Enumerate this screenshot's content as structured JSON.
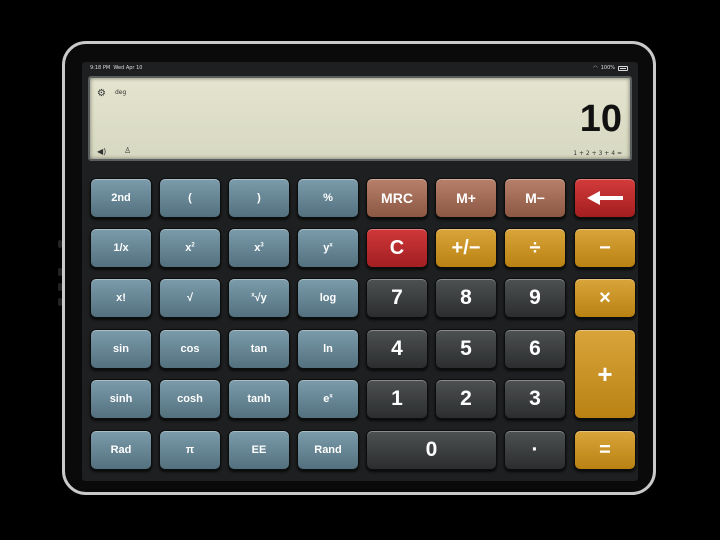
{
  "status_bar": {
    "time": "9:18 PM",
    "date": "Wed Apr 10",
    "battery": "100%",
    "wifi_icon": "wifi-icon",
    "battery_icon": "battery-icon"
  },
  "display": {
    "mode": "deg",
    "value": "10",
    "expression": "1 + 2 + 3 + 4 =",
    "settings_icon": "gear-icon",
    "sound_icon": "speaker-icon",
    "theme_icon": "shirt-icon"
  },
  "keys": {
    "row1": {
      "k1": "2nd",
      "k2": "(",
      "k3": ")",
      "k4": "%",
      "mrc": "MRC",
      "mplus": "M+",
      "mminus": "M−",
      "backspace_icon": "backspace-arrow-icon"
    },
    "row2": {
      "k1": "1/x",
      "k2_base": "x",
      "k2_sup": "2",
      "k3_base": "x",
      "k3_sup": "3",
      "k4_base": "y",
      "k4_sup": "x",
      "clear": "C",
      "sign": "+/−",
      "divide": "÷",
      "minus": "−"
    },
    "row3": {
      "k1": "x!",
      "k2": "√",
      "k3_sup": "x",
      "k3_base": "√y",
      "k4": "log",
      "n7": "7",
      "n8": "8",
      "n9": "9",
      "multiply": "×"
    },
    "row4": {
      "k1": "sin",
      "k2": "cos",
      "k3": "tan",
      "k4": "ln",
      "n4": "4",
      "n5": "5",
      "n6": "6",
      "plus": "+"
    },
    "row5": {
      "k1": "sinh",
      "k2": "cosh",
      "k3": "tanh",
      "k4_base": "e",
      "k4_sup": "x",
      "n1": "1",
      "n2": "2",
      "n3": "3"
    },
    "row6": {
      "k1": "Rad",
      "k2": "π",
      "k3": "EE",
      "k4": "Rand",
      "n0": "0",
      "dot": "·",
      "equals": "="
    }
  },
  "colors": {
    "sci": "#6a8a99",
    "num": "#3b3e3f",
    "mem": "#a26c56",
    "op": "#cc961f",
    "clear": "#c02c2e",
    "lcd": "#dfe0ca"
  }
}
